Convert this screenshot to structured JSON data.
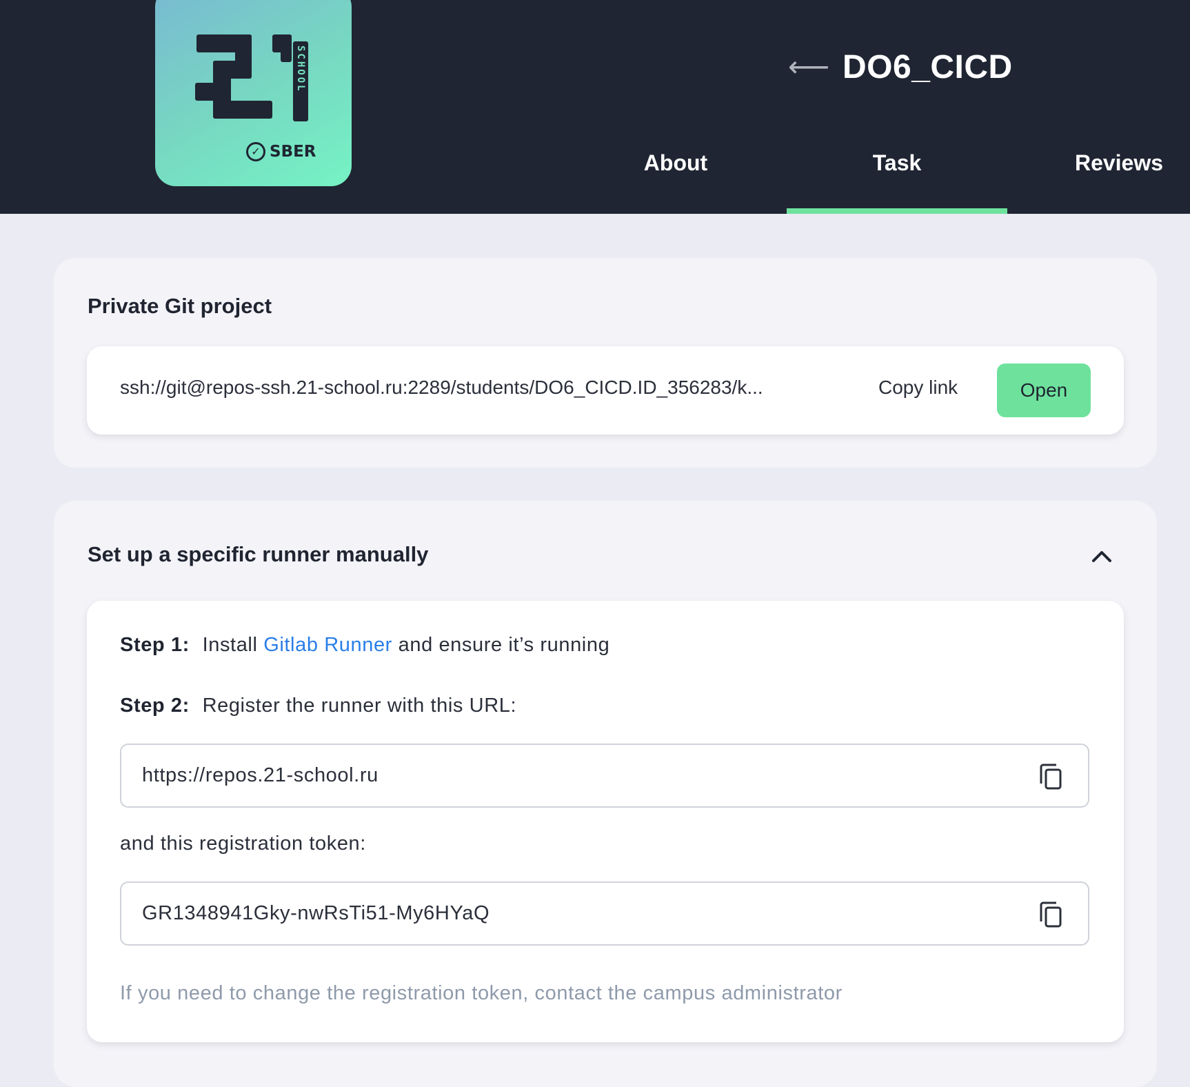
{
  "header": {
    "logo": {
      "number": "21",
      "school": "SCHOOL",
      "brand": "SBER"
    },
    "title": "DO6_CICD",
    "tabs": [
      {
        "label": "About",
        "active": false
      },
      {
        "label": "Task",
        "active": true
      },
      {
        "label": "Reviews",
        "active": false
      }
    ]
  },
  "git_project": {
    "title": "Private Git project",
    "repo_url": "ssh://git@repos-ssh.21-school.ru:2289/students/DO6_CICD.ID_356283/k...",
    "copy_label": "Copy link",
    "open_label": "Open"
  },
  "runner": {
    "title": "Set up a specific runner manually",
    "step1": {
      "label": "Step 1:",
      "before": "Install",
      "link": "Gitlab Runner",
      "after": "and ensure it’s running"
    },
    "step2": {
      "label": "Step 2:",
      "text": "Register the runner with this URL:"
    },
    "url_value": "https://repos.21-school.ru",
    "token_label": "and this registration token:",
    "token_value": "GR1348941Gky-nwRsTi51-My6HYaQ",
    "hint": "If you need to change the registration token, contact the campus administrator"
  },
  "colors": {
    "header_bg": "#1f2532",
    "accent_green": "#6ee29d",
    "link_blue": "#2a7ee8",
    "page_bg": "#ebebf3"
  },
  "icons": [
    "back-arrow-icon",
    "chevron-up-icon",
    "copy-icon",
    "sber-check-icon"
  ]
}
